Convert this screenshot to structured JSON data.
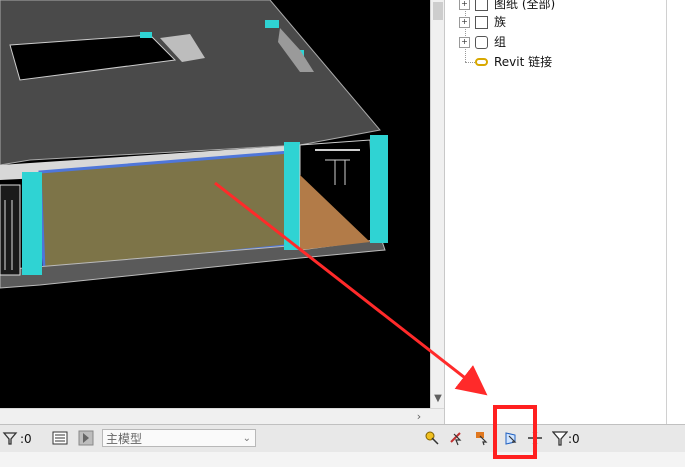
{
  "project_browser": {
    "items": [
      {
        "label": "图纸 (全部)",
        "icon": "sheet-icon",
        "expandable": true
      },
      {
        "label": "族",
        "icon": "family-icon",
        "expandable": true
      },
      {
        "label": "组",
        "icon": "group-icon",
        "expandable": true
      },
      {
        "label": "Revit 链接",
        "icon": "link-icon",
        "expandable": false
      }
    ]
  },
  "statusbar": {
    "count_left": ":0",
    "active_model": "主模型",
    "filter_count": ":0",
    "icons": [
      "visibility-icon",
      "workset-icon",
      "worksharing-icon",
      "display-icon",
      "select-links-icon",
      "select-underlay-icon",
      "drag-icon",
      "filter-icon"
    ]
  },
  "colors": {
    "viewport_bg": "#000000",
    "roof": "#4a4a4a",
    "glass_panel": "#7d7448",
    "accent_cyan": "#2fd3d3",
    "wall_gray": "#b0b0b0",
    "annotation_red": "#ff2a2a"
  }
}
